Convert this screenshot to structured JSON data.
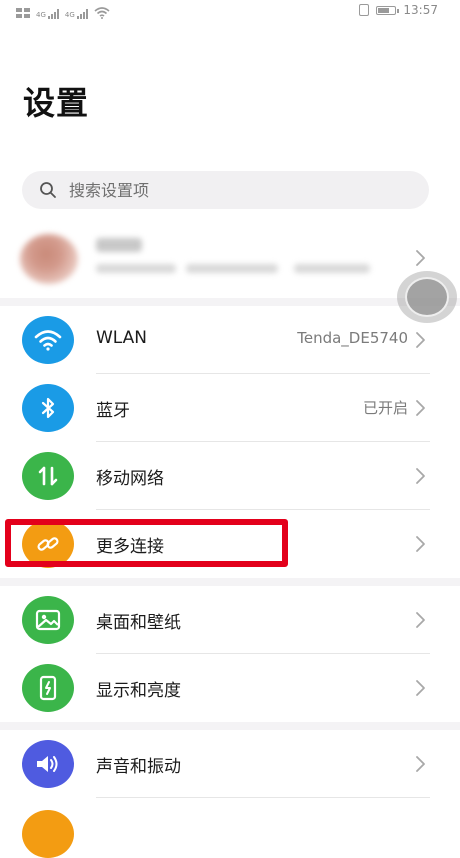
{
  "status_bar": {
    "sim1_tag": "4G",
    "sim2_tag": "4G",
    "battery_level": 0.75,
    "time": "13:57"
  },
  "page": {
    "title": "设置"
  },
  "search": {
    "placeholder": "搜索设置项"
  },
  "groups": [
    {
      "items": [
        {
          "id": "wlan",
          "label": "WLAN",
          "value": "Tenda_DE5740",
          "icon": "wifi-icon",
          "color": "#1a9be6"
        },
        {
          "id": "bluetooth",
          "label": "蓝牙",
          "value": "已开启",
          "icon": "bluetooth-icon",
          "color": "#1a9be6"
        },
        {
          "id": "mobile-network",
          "label": "移动网络",
          "value": "",
          "icon": "mobile-data-icon",
          "color": "#3bb54a"
        },
        {
          "id": "more-connections",
          "label": "更多连接",
          "value": "",
          "icon": "link-icon",
          "color": "#f39c12"
        }
      ]
    },
    {
      "items": [
        {
          "id": "wallpaper",
          "label": "桌面和壁纸",
          "value": "",
          "icon": "picture-icon",
          "color": "#3bb54a"
        },
        {
          "id": "display",
          "label": "显示和亮度",
          "value": "",
          "icon": "phone-brightness-icon",
          "color": "#3bb54a"
        }
      ]
    },
    {
      "items": [
        {
          "id": "sound",
          "label": "声音和振动",
          "value": "",
          "icon": "speaker-icon",
          "color": "#4f5be0"
        }
      ]
    }
  ],
  "colors": {
    "highlight": "#e3001b",
    "next_icon_partial": "#f39c12"
  }
}
